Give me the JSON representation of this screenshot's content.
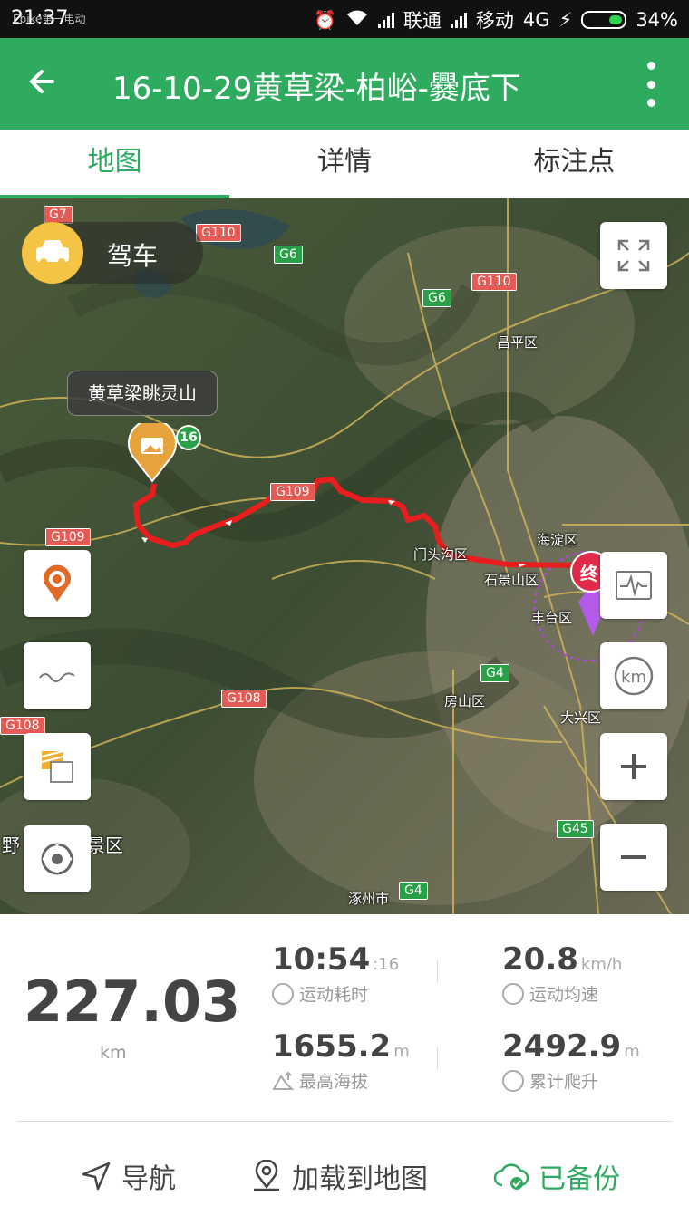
{
  "status": {
    "time": "21:37",
    "watermark": "Ebike第一电动",
    "carrier1": "联通",
    "carrier2": "移动",
    "network": "4G",
    "battery": "34%",
    "battery_level": 0.34
  },
  "header": {
    "title": "16-10-29黄草梁-柏峪-爨底下"
  },
  "tabs": [
    {
      "label": "地图",
      "active": true
    },
    {
      "label": "详情",
      "active": false
    },
    {
      "label": "标注点",
      "active": false
    }
  ],
  "map": {
    "mode_label": "驾车",
    "poi_label": "黄草梁眺灵山",
    "route_badge": "16",
    "end_marker": "终",
    "roads": [
      "G7",
      "G110",
      "G6",
      "G110",
      "G6",
      "G109",
      "G108",
      "G108",
      "G4",
      "G45",
      "G4",
      "G109"
    ],
    "places": [
      "昌平区",
      "海淀区",
      "门头沟区",
      "石景山区",
      "丰台区",
      "房山区",
      "大兴区",
      "涿州市",
      "野",
      "景区"
    ]
  },
  "stats": {
    "distance": "227.03",
    "distance_unit": "km",
    "duration_main": "10:54",
    "duration_sec": ":16",
    "duration_label": "运动耗时",
    "speed": "20.8",
    "speed_unit": "km/h",
    "speed_label": "运动均速",
    "max_alt": "1655.2",
    "max_alt_unit": "m",
    "max_alt_label": "最高海拔",
    "climb": "2492.9",
    "climb_unit": "m",
    "climb_label": "累计爬升"
  },
  "actions": {
    "navigate": "导航",
    "load_to_map": "加载到地图",
    "backed_up": "已备份"
  }
}
